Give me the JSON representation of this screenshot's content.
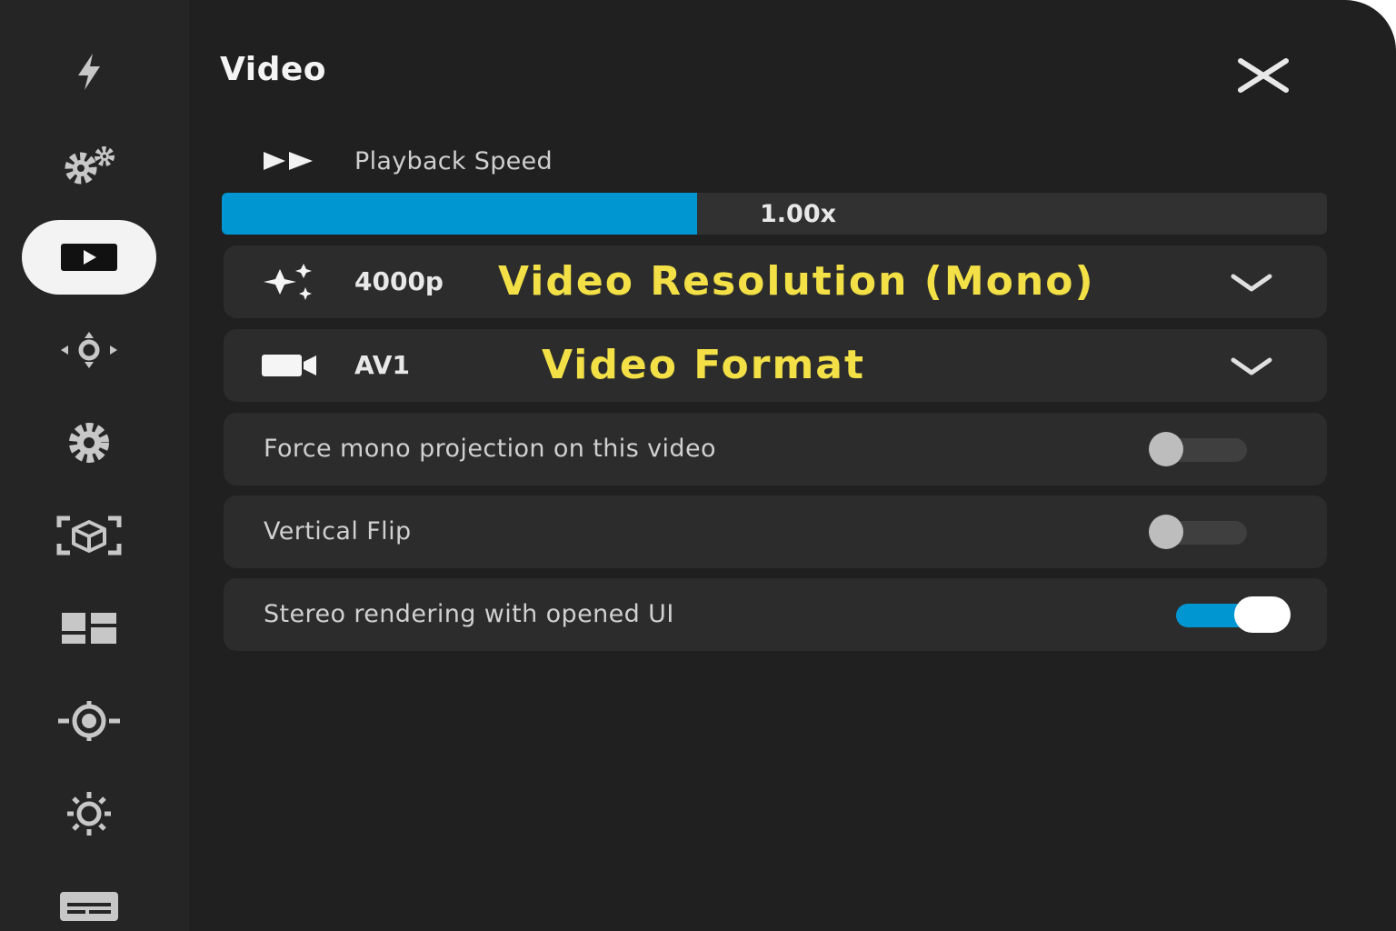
{
  "panel": {
    "title": "Video",
    "close_icon": "close-icon"
  },
  "sidebar": {
    "items": [
      {
        "icon": "lightning-icon",
        "active": false
      },
      {
        "icon": "gears-icon",
        "active": false
      },
      {
        "icon": "play-icon",
        "active": true
      },
      {
        "icon": "move-arrows-icon",
        "active": false
      },
      {
        "icon": "gear-icon",
        "active": false
      },
      {
        "icon": "cube-scan-icon",
        "active": false
      },
      {
        "icon": "dashboard-grid-icon",
        "active": false
      },
      {
        "icon": "target-icon",
        "active": false
      },
      {
        "icon": "brightness-icon",
        "active": false
      },
      {
        "icon": "subtitles-icon",
        "active": false
      }
    ]
  },
  "playback": {
    "icon": "fast-forward-icon",
    "label": "Playback Speed",
    "value_text": "1.00x",
    "fill_fraction": 0.43
  },
  "resolution": {
    "icon": "sparkle-icon",
    "value": "4000p",
    "label": "Video Resolution (Mono)",
    "chevron": "chevron-down-icon"
  },
  "format": {
    "icon": "video-camera-icon",
    "value": "AV1",
    "label": "Video Format",
    "chevron": "chevron-down-icon"
  },
  "toggles": [
    {
      "label": "Force mono projection on this video",
      "on": false
    },
    {
      "label": "Vertical Flip",
      "on": false
    },
    {
      "label": "Stereo rendering with opened UI",
      "on": true
    }
  ],
  "colors": {
    "accent": "#0096d1",
    "label_highlight": "#f2e046",
    "background": "#202020",
    "sidebar": "#252525",
    "card": "#2c2c2c"
  }
}
